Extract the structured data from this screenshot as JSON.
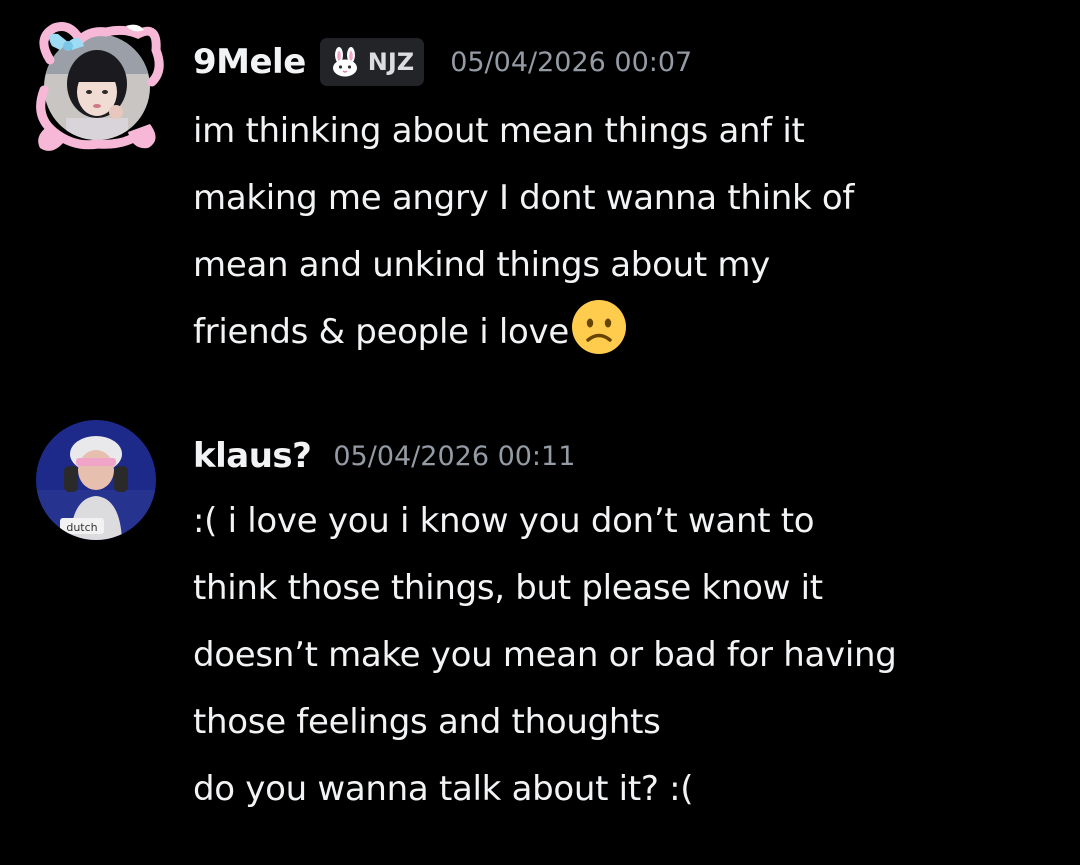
{
  "messages": [
    {
      "username": "9Mele",
      "tag": {
        "icon": "bunny-icon",
        "text": "NJZ"
      },
      "timestamp": "05/04/2026 00:07",
      "lines": [
        "im thinking about mean things anf it",
        "making me angry I dont wanna think of",
        "mean and unkind things about my",
        "friends & people i love"
      ],
      "trailing_emoji": "frowning-face-icon"
    },
    {
      "username": "klaus?",
      "avatar_caption": "dutch",
      "timestamp": "05/04/2026 00:11",
      "lines": [
        ":( i love you i know you don’t want to",
        "think those things, but please know it",
        "doesn’t make you mean or bad for having",
        "those feelings and thoughts"
      ],
      "followup": "do you wanna talk about it? :("
    }
  ],
  "colors": {
    "background": "#000000",
    "text": "#f2f3f5",
    "timestamp": "#949ba4",
    "tag_bg": "#232428",
    "avatar_deco_pink": "#f7b8d8"
  }
}
